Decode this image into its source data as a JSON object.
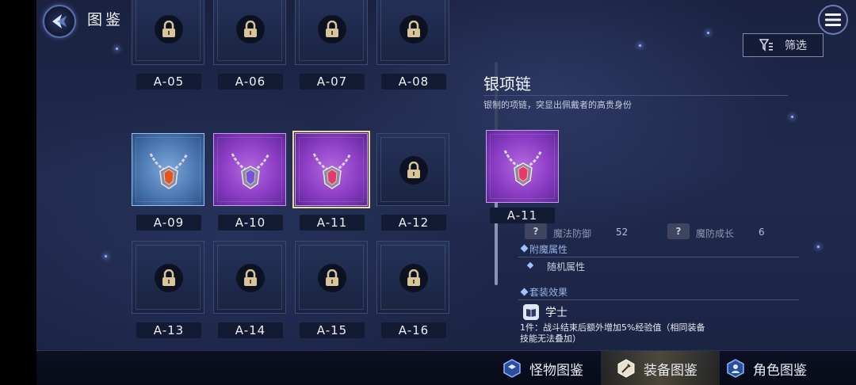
{
  "header": {
    "title": "图鉴",
    "back_icon": "back-arrow-icon",
    "menu_icon": "hamburger-menu-icon",
    "filter_label": "筛选",
    "filter_icon": "filter-icon"
  },
  "grid": {
    "items": [
      {
        "code": "A-05",
        "state": "locked"
      },
      {
        "code": "A-06",
        "state": "locked"
      },
      {
        "code": "A-07",
        "state": "locked"
      },
      {
        "code": "A-08",
        "state": "locked"
      },
      {
        "code": "A-09",
        "state": "unlocked",
        "rarity_color": "#5a86c4",
        "gem_color": "#e0561f"
      },
      {
        "code": "A-10",
        "state": "unlocked",
        "rarity_color": "#8b3dc4",
        "gem_color": "#7a52d6"
      },
      {
        "code": "A-11",
        "state": "selected",
        "rarity_color": "#8b3dc4",
        "gem_color": "#e23a6a"
      },
      {
        "code": "A-12",
        "state": "locked"
      },
      {
        "code": "A-13",
        "state": "locked"
      },
      {
        "code": "A-14",
        "state": "locked"
      },
      {
        "code": "A-15",
        "state": "locked"
      },
      {
        "code": "A-16",
        "state": "locked"
      }
    ]
  },
  "detail": {
    "name": "银项链",
    "description": "银制的项链，突显出佩戴者的高贵身份",
    "code": "A-11",
    "stats": [
      {
        "icon": "question-icon",
        "name": "魔法防御",
        "value": "52"
      },
      {
        "icon": "question-icon",
        "name": "魔防成长",
        "value": "6"
      }
    ],
    "enchant_title": "附魔属性",
    "enchant_items": [
      "随机属性"
    ],
    "set_title": "套装效果",
    "set_name": "学士",
    "set_icon": "book-icon",
    "set_effect_line1": "1件：战斗结束后额外增加5%经验值（相同装备",
    "set_effect_line2": "技能无法叠加）"
  },
  "bottom_tabs": [
    {
      "label": "怪物图鉴",
      "icon": "hexagon-cube-icon",
      "active": false
    },
    {
      "label": "装备图鉴",
      "icon": "hexagon-sword-icon",
      "active": true
    },
    {
      "label": "角色图鉴",
      "icon": "hexagon-person-icon",
      "active": false
    }
  ],
  "colors": {
    "accent_gold": "#f1d79c",
    "purple_rarity": "#8b3dc4",
    "blue_rarity": "#5a86c4"
  }
}
